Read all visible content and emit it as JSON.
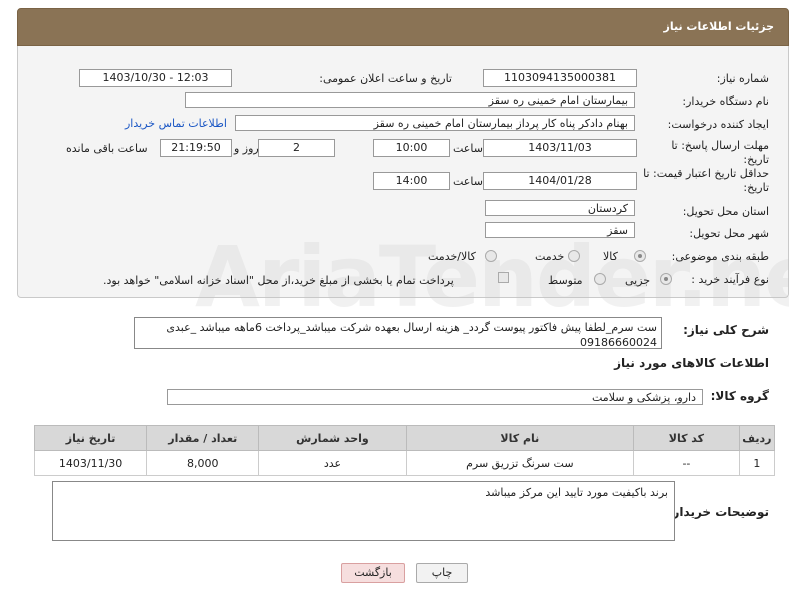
{
  "header": {
    "title": "جزئیات اطلاعات نیاز"
  },
  "fields": {
    "need_number_label": "شماره نیاز:",
    "need_number": "1103094135000381",
    "announce_label": "تاریخ و ساعت اعلان عمومی:",
    "announce_value": "1403/10/30 - 12:03",
    "buyer_org_label": "نام دستگاه خریدار:",
    "buyer_org": "بیمارستان امام خمینی  ره  سقز",
    "creator_label": "ایجاد کننده درخواست:",
    "creator": "بهنام دادکر پناه کار پرداز بیمارستان امام خمینی  ره  سقز",
    "contact_link": "اطلاعات تماس خریدار",
    "deadline_label_1": "مهلت ارسال پاسخ: تا",
    "deadline_label_2": "تاریخ:",
    "deadline_date": "1403/11/03",
    "time_label": "ساعت",
    "deadline_time": "10:00",
    "days_value": "2",
    "days_label": "روز و",
    "remaining_value": "21:19:50",
    "remaining_label": "ساعت باقی مانده",
    "min_valid_label_1": "حداقل تاریخ اعتبار قیمت: تا",
    "min_valid_label_2": "تاریخ:",
    "min_valid_date": "1404/01/28",
    "min_valid_time_label": "ساعت",
    "min_valid_time": "14:00",
    "province_label": "استان محل تحویل:",
    "province": "کردستان",
    "city_label": "شهر محل تحویل:",
    "city": "سقز",
    "category_label": "طبقه بندی موضوعی:",
    "category_options": [
      "کالا",
      "خدمت",
      "کالا/خدمت"
    ],
    "process_label": "نوع فرآیند خرید :",
    "process_options": [
      "جزیی",
      "متوسط"
    ],
    "payment_note": "پرداخت تمام یا بخشی از مبلغ خرید،از محل \"اسناد خزانه اسلامی\" خواهد بود."
  },
  "description": {
    "label": "شرح کلی نیاز:",
    "text": "ست سرم_لطفا پیش فاکتور پیوست گردد_ هزینه ارسال بعهده شرکت میباشد_پرداخت 6ماهه میباشد _عبدی 09186660024"
  },
  "goods_info": {
    "title": "اطلاعات کالاهای مورد نیاز",
    "group_label": "گروه کالا:",
    "group_value": "دارو، پزشکی و سلامت"
  },
  "table": {
    "headers": [
      "ردیف",
      "کد کالا",
      "نام کالا",
      "واحد شمارش",
      "تعداد / مقدار",
      "تاریخ نیاز"
    ],
    "rows": [
      [
        "1",
        "--",
        "ست سرنگ تزریق سرم",
        "عدد",
        "8,000",
        "1403/11/30"
      ]
    ]
  },
  "buyer_notes": {
    "label": "توضیحات خریدار:",
    "text": "برند باکیفیت مورد تایید این مرکز میباشد"
  },
  "buttons": {
    "print": "چاپ",
    "back": "بازگشت"
  },
  "watermark": "AriaTender.neT"
}
